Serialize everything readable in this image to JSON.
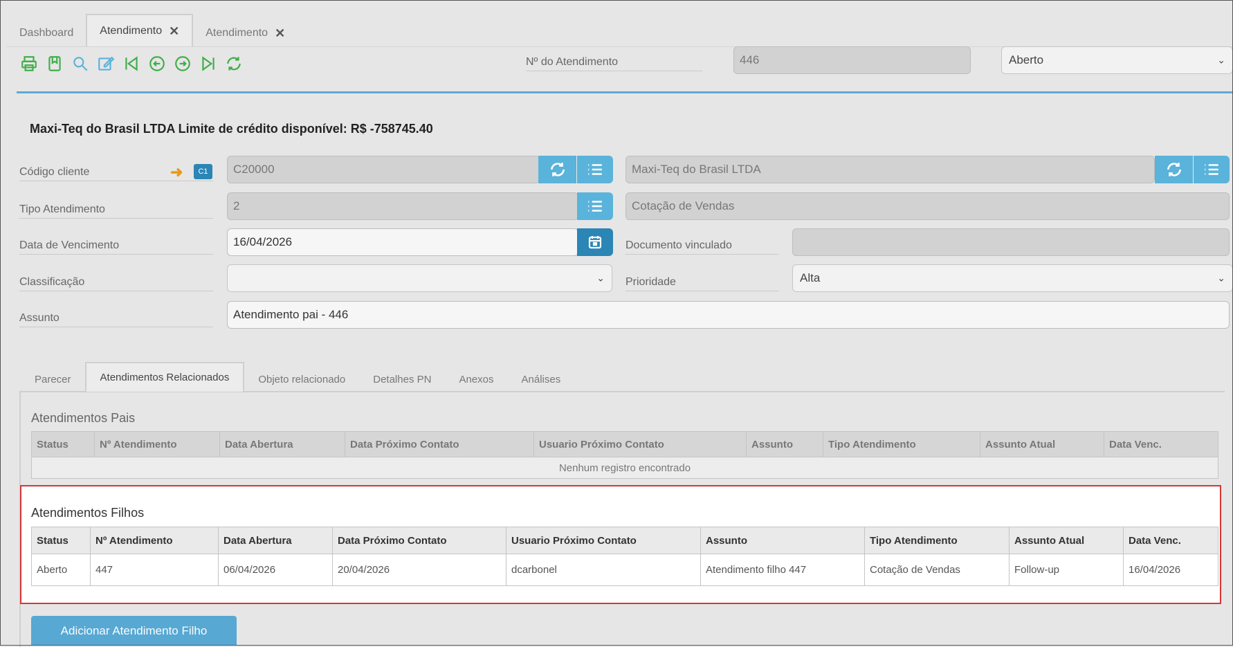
{
  "tabs": [
    {
      "label": "Dashboard",
      "closable": false,
      "active": false
    },
    {
      "label": "Atendimento",
      "closable": true,
      "active": true
    },
    {
      "label": "Atendimento",
      "closable": true,
      "active": false
    }
  ],
  "toolbar_icons": [
    "printer-icon",
    "bookmark-icon",
    "search-icon",
    "edit-icon",
    "first-icon",
    "previous-icon",
    "next-icon",
    "last-icon",
    "refresh-icon"
  ],
  "header": {
    "num_label": "Nº do Atendimento",
    "num_value": "446",
    "status_value": "Aberto",
    "customer_line": "Maxi-Teq do Brasil LTDA Limite de crédito disponível: R$ -758745.40"
  },
  "form": {
    "codigo_label": "Código cliente",
    "codigo_badge": "C1",
    "codigo_value": "C20000",
    "cliente_nome": "Maxi-Teq do Brasil LTDA",
    "tipo_label": "Tipo Atendimento",
    "tipo_value": "2",
    "tipo_nome": "Cotação de Vendas",
    "venc_label": "Data de Vencimento",
    "venc_value": "16/04/2026",
    "doc_label": "Documento vinculado",
    "doc_value": "",
    "class_label": "Classificação",
    "class_value": "",
    "prio_label": "Prioridade",
    "prio_value": "Alta",
    "assunto_label": "Assunto",
    "assunto_value": "Atendimento pai - 446"
  },
  "inner_tabs": [
    "Parecer",
    "Atendimentos Relacionados",
    "Objeto relacionado",
    "Detalhes PN",
    "Anexos",
    "Análises"
  ],
  "pais": {
    "title": "Atendimentos Pais",
    "columns": [
      "Status",
      "Nº Atendimento",
      "Data Abertura",
      "Data Próximo Contato",
      "Usuario Próximo Contato",
      "Assunto",
      "Tipo Atendimento",
      "Assunto Atual",
      "Data Venc."
    ],
    "empty": "Nenhum registro encontrado"
  },
  "filhos": {
    "title": "Atendimentos Filhos",
    "columns": [
      "Status",
      "Nº Atendimento",
      "Data Abertura",
      "Data Próximo Contato",
      "Usuario Próximo Contato",
      "Assunto",
      "Tipo Atendimento",
      "Assunto Atual",
      "Data Venc."
    ],
    "rows": [
      [
        "Aberto",
        "447",
        "06/04/2026",
        "20/04/2026",
        "dcarbonel",
        "Atendimento filho 447",
        "Cotação de Vendas",
        "Follow-up",
        "16/04/2026"
      ]
    ]
  },
  "add_button": "Adicionar Atendimento Filho",
  "colors": {
    "accent": "#5ab3da",
    "toolbar": "#3fae49",
    "highlight": "#d73636"
  }
}
